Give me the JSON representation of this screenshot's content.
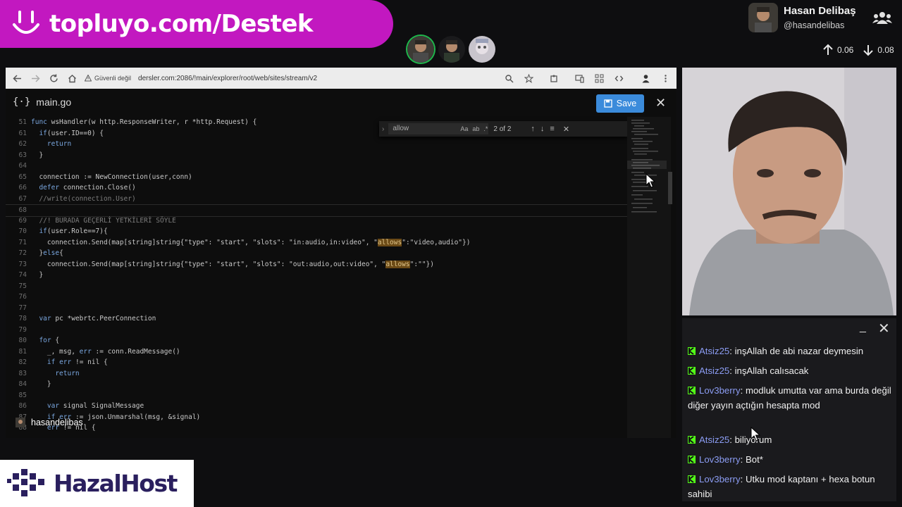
{
  "banner": {
    "text": "topluyo.com/Destek"
  },
  "profile": {
    "name": "Hasan Delibaş",
    "handle": "@hasandelibas",
    "upload": "0.06",
    "download": "0.08"
  },
  "browser": {
    "security": "Güvenli değil",
    "url": "dersler.com:2086/!main/explorer/root/web/sites/stream/v2"
  },
  "editor": {
    "file_name": "main.go",
    "save_label": "Save",
    "find": {
      "query": "allow",
      "count": "2 of 2"
    },
    "lines": [
      {
        "no": "51",
        "text": "func wsHandler(w http.ResponseWriter, r *http.Request) {"
      },
      {
        "no": "61",
        "text": "  if(user.ID==0) {"
      },
      {
        "no": "62",
        "text": "    return"
      },
      {
        "no": "63",
        "text": "  }"
      },
      {
        "no": "64",
        "text": ""
      },
      {
        "no": "65",
        "text": "  connection := NewConnection(user,conn)"
      },
      {
        "no": "66",
        "text": "  defer connection.Close()"
      },
      {
        "no": "67",
        "text": "  //write(connection.User)"
      },
      {
        "no": "68",
        "text": ""
      },
      {
        "no": "69",
        "text": "  //! BURADA GEÇERLİ YETKİLERİ SÖYLE"
      },
      {
        "no": "70",
        "text": "  if(user.Role==7){"
      },
      {
        "no": "71",
        "text": "    connection.Send(map[string]string{\"type\": \"start\", \"slots\": \"in:audio,in:video\", \"allows\":\"video,audio\"})"
      },
      {
        "no": "72",
        "text": "  }else{"
      },
      {
        "no": "73",
        "text": "    connection.Send(map[string]string{\"type\": \"start\", \"slots\": \"out:audio,out:video\", \"allows\":\"\"})"
      },
      {
        "no": "74",
        "text": "  }"
      },
      {
        "no": "75",
        "text": ""
      },
      {
        "no": "76",
        "text": ""
      },
      {
        "no": "77",
        "text": ""
      },
      {
        "no": "78",
        "text": "  var pc *webrtc.PeerConnection"
      },
      {
        "no": "79",
        "text": ""
      },
      {
        "no": "80",
        "text": "  for {"
      },
      {
        "no": "81",
        "text": "    _, msg, err := conn.ReadMessage()"
      },
      {
        "no": "82",
        "text": "    if err != nil {"
      },
      {
        "no": "83",
        "text": "      return"
      },
      {
        "no": "84",
        "text": "    }"
      },
      {
        "no": "85",
        "text": ""
      },
      {
        "no": "86",
        "text": "    var signal SignalMessage"
      },
      {
        "no": "87",
        "text": "    if err := json.Unmarshal(msg, &signal)"
      },
      {
        "no": "88",
        "text": "    err != nil {"
      }
    ]
  },
  "streamer_tag": "hasandelibas",
  "chat": {
    "messages": [
      {
        "user": "Atsiz25",
        "text": "inşAllah de abi nazar deymesin"
      },
      {
        "user": "Atsiz25",
        "text": "inşAllah calısacak"
      },
      {
        "user": "Lov3berry",
        "text": "modluk umutta var ama burda değil diğer yayın açtığın hesapta mod"
      },
      {
        "user": "Atsiz25",
        "text": "biliyorum"
      },
      {
        "user": "Lov3berry",
        "text": "Bot*"
      },
      {
        "user": "Lov3berry",
        "text": "Utku mod kaptanı + hexa botun sahibi"
      }
    ]
  },
  "logo": {
    "text": "HazalHost"
  },
  "colors": {
    "banner": "#c218c0",
    "save": "#3b8bdb",
    "chat_user": "#8b9cf2",
    "kick_green": "#53fc18",
    "find_highlight": "#6b4a16"
  }
}
